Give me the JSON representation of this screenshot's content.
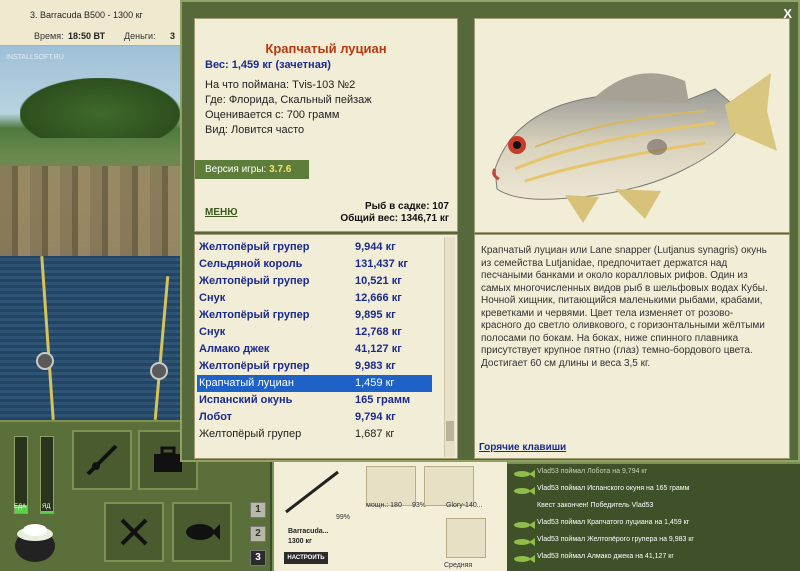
{
  "topbar": {
    "boat": "3. Barracuda B500 - 1300 кг",
    "time_label": "Время:",
    "time_value": "18:50 ВТ",
    "money_label": "Деньги:",
    "money_value": "3"
  },
  "scene": {
    "watermark": "INSTALLSOFT.RU"
  },
  "bottom": {
    "gauge_food": "ЕДА",
    "gauge_poison": "ЯД",
    "food_level": 0.1,
    "poison_level": 0.02,
    "num_buttons": [
      "1",
      "2",
      "3"
    ]
  },
  "tackle": {
    "percent_rod": "99%",
    "rod_name": "Barracuda...",
    "rod_weight": "1300 кг",
    "setup_label": "НАСТРОИТЬ",
    "power": "мощн.: 180",
    "percent_reel": "93%",
    "lure_name": "Glory-140...",
    "lure_type": "Средняя"
  },
  "chat": {
    "lines": [
      {
        "text": "Vlad53 поймал Лобота на 9,794 кг",
        "fish": true,
        "dim": true
      },
      {
        "text": "Vlad53 поймал Испанского окуня на 165 грамм",
        "fish": true,
        "dim": false
      },
      {
        "text": "Квест закончен! Победитель Vlad53",
        "fish": false,
        "dim": false
      },
      {
        "text": "Vlad53 поймал Крапчатого луциана на 1,459 кг",
        "fish": true,
        "dim": false
      },
      {
        "text": "Vlad53 поймал Желтопёрого групера на 9,983 кг",
        "fish": true,
        "dim": false
      },
      {
        "text": "Vlad53 поймал Алмако джека на 41,127 кг",
        "fish": true,
        "dim": false
      }
    ]
  },
  "dialog": {
    "close": "X",
    "fish_name": "Крапчатый луциан",
    "weight_line": "Вес: 1,459 кг (зачетная)",
    "caught_with": "На что поймана: Tvis-103 №2",
    "where": "Где: Флорида, Скальный пейзаж",
    "valued_from": "Оценивается с: 700 грамм",
    "view": "Вид: Ловится часто",
    "version_label": "Версия игры: ",
    "version_value": "3.7.6",
    "menu": "МЕНЮ",
    "fish_in_cage": "Рыб в садке: 107",
    "total_weight": "Общий вес: 1346,71 кг",
    "hotkeys": "Горячие клавиши",
    "description": "Крапчатый луциан или Lane snapper (Lutjanus synagris) окунь из семейства Lutjanidae, предпочитает держатся над песчаными банками и около коралловых рифов. Один из самых многочисленных видов рыб в шельфовых водах Кубы. Ночной хищник, питающийся маленькими рыбами, крабами, креветками и червями. Цвет тела изменяет от розово-красного до светло оливкового, с горизонтальными жёлтыми полосами по бокам. На боках, ниже спинного плавника присутствует крупное пятно (глаз) темно-бордового цвета. Достигает 60 см длины и веса 3,5 кг."
  },
  "catch_list": [
    {
      "name": "Желтопёрый групер",
      "weight": "9,944 кг",
      "style": "bold"
    },
    {
      "name": "Сельдяной король",
      "weight": "131,437 кг",
      "style": "bold"
    },
    {
      "name": "Желтопёрый групер",
      "weight": "10,521 кг",
      "style": "bold"
    },
    {
      "name": "Снук",
      "weight": "12,666 кг",
      "style": "bold"
    },
    {
      "name": "Желтопёрый групер",
      "weight": "9,895 кг",
      "style": "bold"
    },
    {
      "name": "Снук",
      "weight": "12,768 кг",
      "style": "bold"
    },
    {
      "name": "Алмако джек",
      "weight": "41,127 кг",
      "style": "bold"
    },
    {
      "name": "Желтопёрый групер",
      "weight": "9,983 кг",
      "style": "bold"
    },
    {
      "name": "Крапчатый луциан",
      "weight": "1,459 кг",
      "style": "selected"
    },
    {
      "name": "Испанский окунь",
      "weight": "165 грамм",
      "style": "bold"
    },
    {
      "name": "Лобот",
      "weight": "9,794 кг",
      "style": "bold"
    },
    {
      "name": "Желтопёрый групер",
      "weight": "1,687 кг",
      "style": "plain"
    }
  ],
  "colors": {
    "title": "#b8390e",
    "accent_blue": "#1b2a8e",
    "selected_row": "#1e62c8",
    "panel_bg": "#f1edd6",
    "frame_green": "#55693a"
  }
}
